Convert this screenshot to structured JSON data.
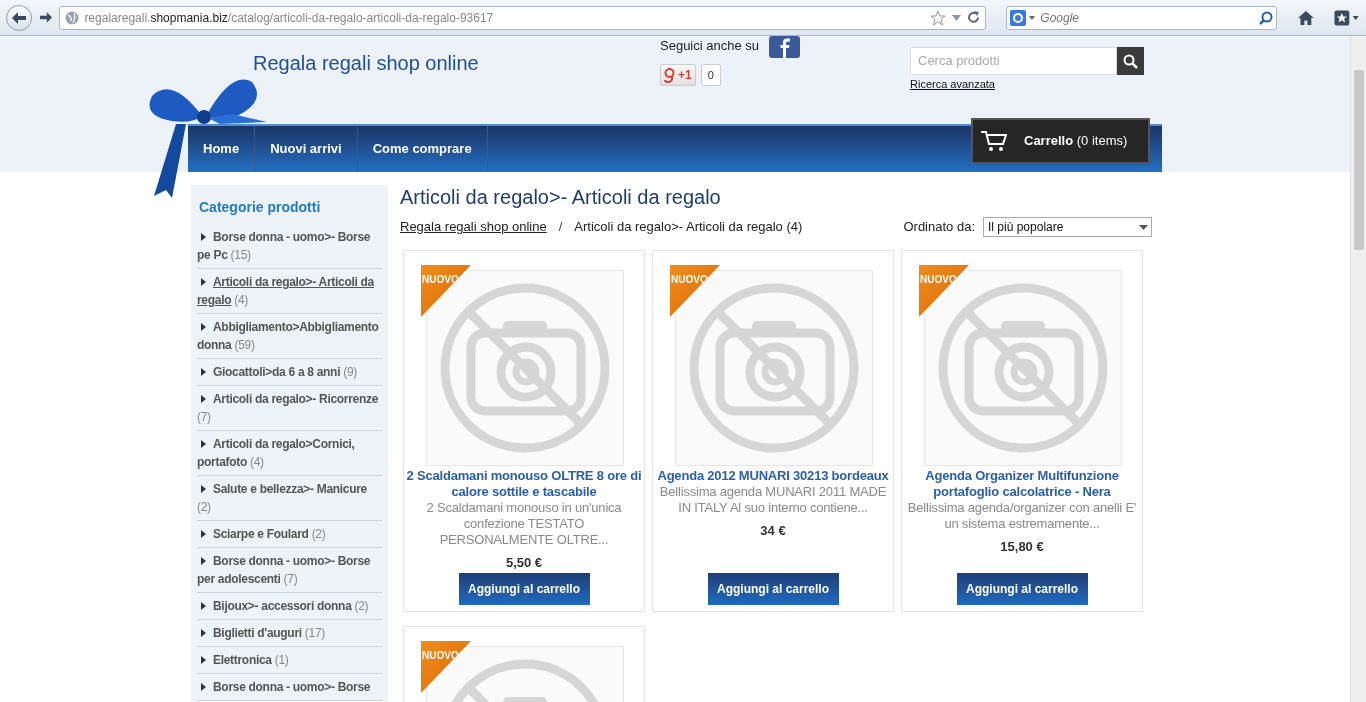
{
  "browser": {
    "url": {
      "subdomain": "regalaregali.",
      "domain": "shopmania.biz",
      "path": "/catalog/articoli-da-regalo-articoli-da-regalo-93617"
    },
    "search_placeholder": "Google"
  },
  "header": {
    "site_title": "Regala regali shop online",
    "follow_label": "Seguici anche su",
    "plus_label": "+1",
    "plus_count": "0",
    "search_placeholder": "Cerca prodotti",
    "advanced_search": "Ricerca avanzata"
  },
  "nav": {
    "items": [
      "Home",
      "Nuovi arrivi",
      "Come comprare"
    ],
    "cart": {
      "label": "Carrello",
      "count": "(0 items)"
    }
  },
  "sidebar": {
    "title": "Categorie prodotti",
    "items": [
      {
        "label": "Borse donna - uomo>- Borse pe Pc",
        "count": "(15)",
        "selected": false
      },
      {
        "label": "Articoli da regalo>- Articoli da regalo",
        "count": "(4)",
        "selected": true
      },
      {
        "label": "Abbigliamento>Abbigliamento donna",
        "count": "(59)",
        "selected": false
      },
      {
        "label": "Giocattoli>da 6 a 8 anni",
        "count": "(9)",
        "selected": false
      },
      {
        "label": "Articoli da regalo>- Ricorrenze",
        "count": "(7)",
        "selected": false
      },
      {
        "label": "Articoli da regalo>Cornici, portafoto",
        "count": "(4)",
        "selected": false
      },
      {
        "label": "Salute e bellezza>- Manicure",
        "count": "(2)",
        "selected": false
      },
      {
        "label": "Sciarpe e Foulard",
        "count": "(2)",
        "selected": false
      },
      {
        "label": "Borse donna - uomo>- Borse per adolescenti",
        "count": "(7)",
        "selected": false
      },
      {
        "label": "Bijoux>- accessori donna",
        "count": "(2)",
        "selected": false
      },
      {
        "label": "Biglietti d'auguri",
        "count": "(17)",
        "selected": false
      },
      {
        "label": "Elettronica",
        "count": "(1)",
        "selected": false
      },
      {
        "label": "Borse donna - uomo>- Borse",
        "selected": false
      }
    ]
  },
  "content": {
    "heading": "Articoli da regalo>- Articoli da regalo",
    "breadcrumb": {
      "home": "Regala regali shop online",
      "separator": "/",
      "current": "Articoli da regalo>- Articoli da regalo (4)"
    },
    "sort": {
      "label": "Ordinato da:",
      "value": "Il più popolare"
    }
  },
  "products": [
    {
      "badge": "NUOVO",
      "title": "2 Scaldamani monouso OLTRE 8 ore di calore sottile e tascabile",
      "description": "2 Scaldamani monouso in un'unica confezione TESTATO PERSONALMENTE OLTRE...",
      "price": "5,50 €",
      "button": "Aggiungi al carrello"
    },
    {
      "badge": "NUOVO",
      "title": "Agenda 2012 MUNARI 30213 bordeaux",
      "description": "Bellissima agenda MUNARI 2011 MADE IN ITALY Al suo interno contiene...",
      "price": "34 €",
      "button": "Aggiungi al carrello"
    },
    {
      "badge": "NUOVO",
      "title": "Agenda Organizer Multifunzione portafoglio calcolatrice - Nera",
      "description": "Bellissima agenda/organizer con anelli E' un sistema estremamente...",
      "price": "15,80 €",
      "button": "Aggiungi al carrello"
    },
    {
      "badge": "NUOVO"
    }
  ]
}
